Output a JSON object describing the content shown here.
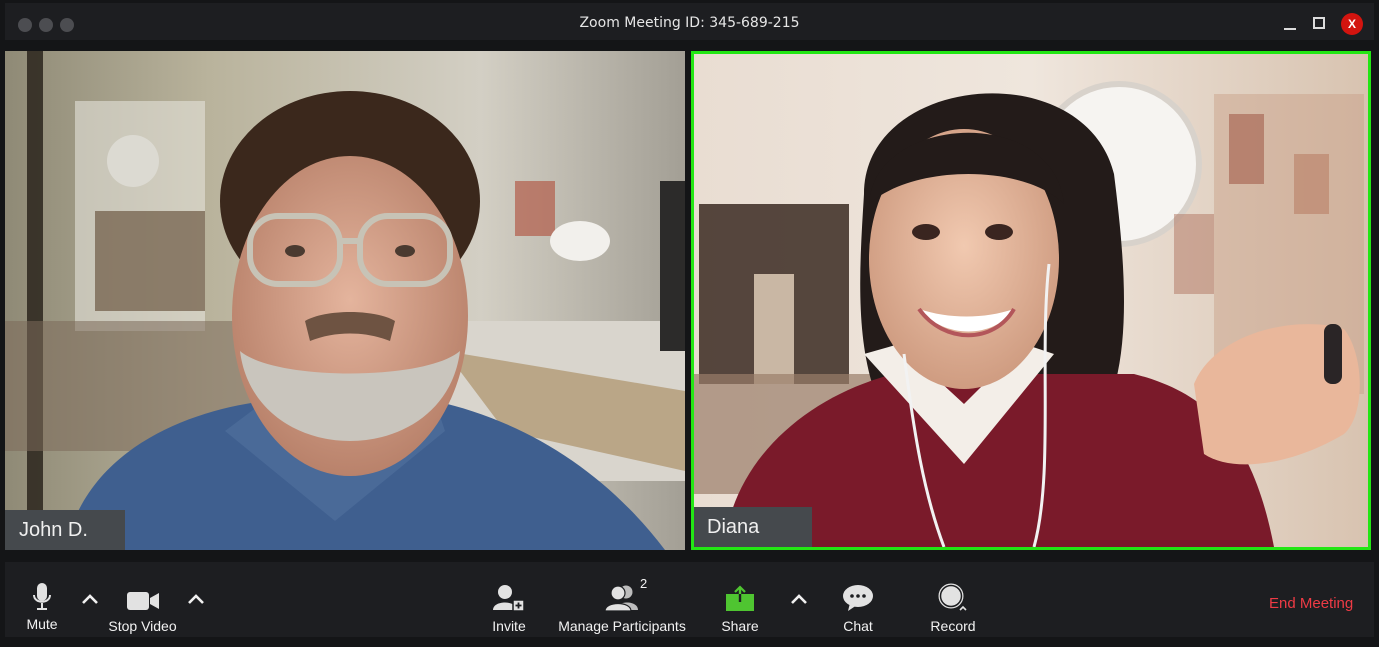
{
  "window": {
    "title": "Zoom Meeting ID: 345-689-215",
    "controls": {
      "close_label": "x"
    }
  },
  "participants": [
    {
      "name": "John D.",
      "active_speaker": false
    },
    {
      "name": "Diana",
      "active_speaker": true
    }
  ],
  "colors": {
    "active_speaker_border": "#23e614",
    "end_meeting": "#ee3b45",
    "share_green": "#4fc531",
    "close_red": "#d3140f"
  },
  "toolbar": {
    "mute_label": "Mute",
    "stop_video_label": "Stop Video",
    "invite_label": "Invite",
    "manage_participants_label": "Manage Participants",
    "participant_count": "2",
    "share_label": "Share",
    "chat_label": "Chat",
    "record_label": "Record",
    "end_meeting_label": "End Meeting"
  }
}
